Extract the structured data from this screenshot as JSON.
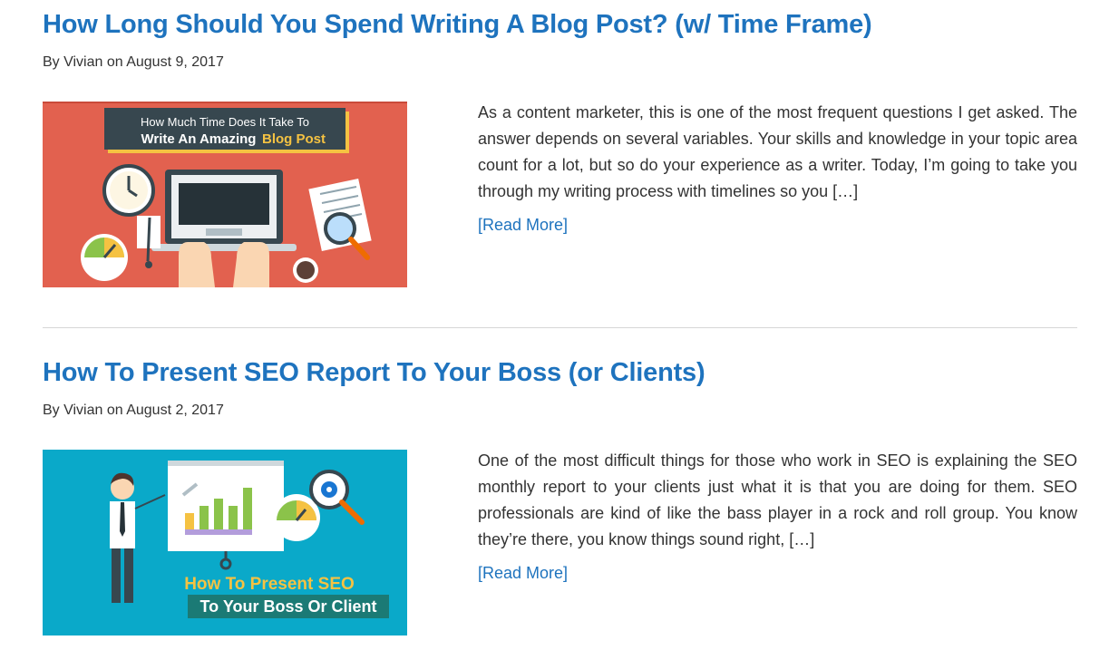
{
  "posts": [
    {
      "title": "How Long Should You Spend Writing A Blog Post? (w/ Time Frame)",
      "meta": "By Vivian on August 9, 2017",
      "excerpt": "As a content marketer, this is one of the most frequent questions I get asked. The answer depends on several variables. Your skills and knowledge in your topic area count for a lot, but so do your experience as a writer. Today, I’m going to take you through my writing process with timelines so you […]",
      "read_more": "[Read More]",
      "thumb": {
        "line1": "How Much Time Does It Take To",
        "line2_prefix": "Write An Amazing",
        "line2_highlight": "Blog Post",
        "bg": "#e2614f"
      }
    },
    {
      "title": "How To Present SEO Report To Your Boss (or Clients)",
      "meta": "By Vivian on August 2, 2017",
      "excerpt": "One of the most difficult things for those who work in SEO is explaining the SEO monthly report to your clients just what it is that you are doing for them. SEO professionals are kind of like the bass player in a rock and roll group. You know they’re there, you know things sound right, […]",
      "read_more": "[Read More]",
      "thumb": {
        "line1": "How To Present SEO",
        "line2": "To Your Boss Or Client",
        "bg": "#0aa9c9"
      }
    }
  ],
  "colors": {
    "link": "#1e73be",
    "accent_yellow": "#f5c242"
  }
}
